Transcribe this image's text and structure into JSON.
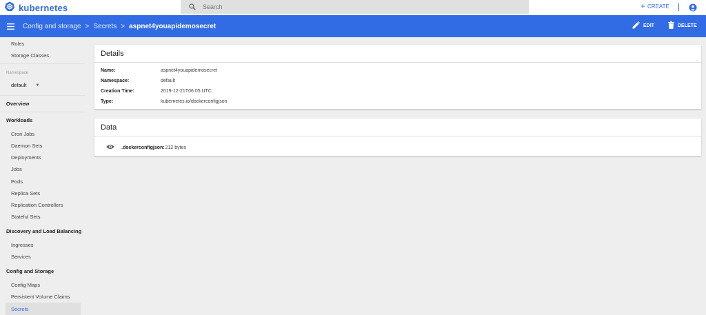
{
  "app": {
    "logo_text": "kubernetes",
    "brand_color": "#326ce5"
  },
  "search": {
    "placeholder": "Search",
    "value": ""
  },
  "topbar": {
    "create_label": "CREATE",
    "create_icon": "plus-icon",
    "account_icon": "account-circle-icon"
  },
  "breadcrumb": {
    "menu_icon": "menu-icon",
    "items": [
      "Config and storage",
      "Secrets"
    ],
    "separator": ">",
    "current": "aspnet4youapidemosecret"
  },
  "actions": {
    "edit_label": "EDIT",
    "edit_icon": "pencil-icon",
    "delete_label": "DELETE",
    "delete_icon": "trash-icon"
  },
  "sidebar": {
    "top_items": [
      "Roles",
      "Storage Classes"
    ],
    "namespace_label": "Namespace",
    "namespace_value": "default",
    "overview": "Overview",
    "workloads": {
      "heading": "Workloads",
      "items": [
        "Cron Jobs",
        "Daemon Sets",
        "Deployments",
        "Jobs",
        "Pods",
        "Replica Sets",
        "Replication Controllers",
        "Stateful Sets"
      ]
    },
    "discovery": {
      "heading": "Discovery and Load Balancing",
      "items": [
        "Ingresses",
        "Services"
      ]
    },
    "config": {
      "heading": "Config and Storage",
      "items": [
        "Config Maps",
        "Persistent Volume Claims",
        "Secrets"
      ]
    },
    "selected": "Secrets"
  },
  "details": {
    "title": "Details",
    "rows": [
      {
        "key": "Name:",
        "value": "aspnet4youapidemosecret"
      },
      {
        "key": "Namespace:",
        "value": "default"
      },
      {
        "key": "Creation Time:",
        "value": "2019-12-21T06:05 UTC"
      },
      {
        "key": "Type:",
        "value": "kubernetes.io/dockerconfigjson"
      }
    ]
  },
  "data": {
    "title": "Data",
    "entry_key": ".dockerconfigjson:",
    "entry_value": "212 bytes",
    "entry_icon": "eye-icon"
  }
}
